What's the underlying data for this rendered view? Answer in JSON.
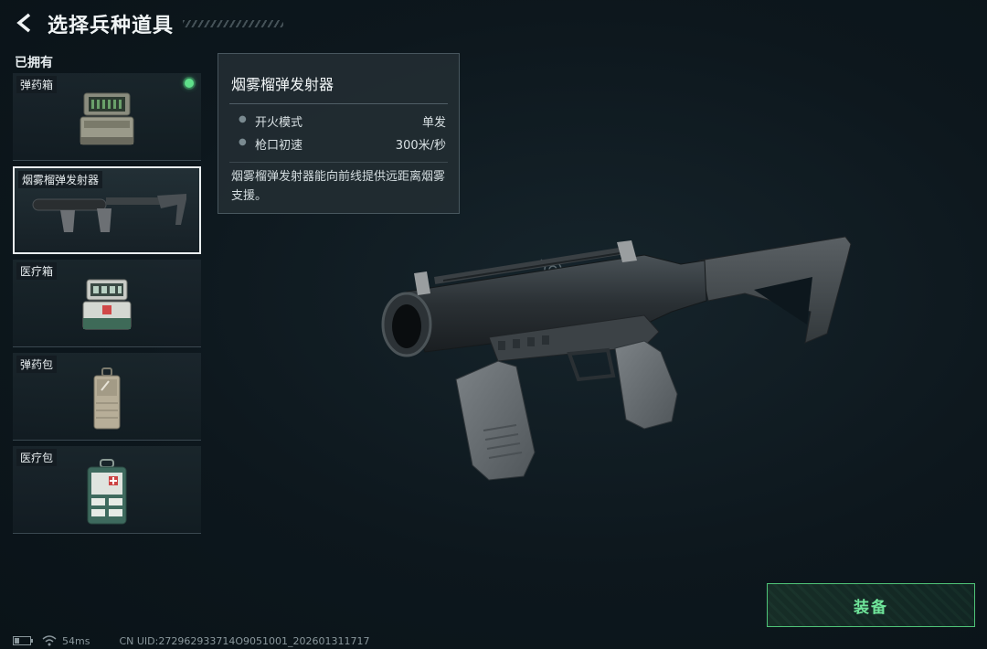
{
  "header": {
    "title": "选择兵种道具",
    "back_icon": "back-arrow-icon"
  },
  "section": {
    "owned_label": "已拥有"
  },
  "items": [
    {
      "label": "弹药箱",
      "icon": "ammo-box-icon",
      "owned_indicator": true,
      "selected": false
    },
    {
      "label": "烟雾榴弹发射器",
      "icon": "smoke-grenade-launcher-icon",
      "owned_indicator": false,
      "selected": true
    },
    {
      "label": "医疗箱",
      "icon": "medical-box-icon",
      "owned_indicator": false,
      "selected": false
    },
    {
      "label": "弹药包",
      "icon": "ammo-pouch-icon",
      "owned_indicator": false,
      "selected": false
    },
    {
      "label": "医疗包",
      "icon": "medical-pouch-icon",
      "owned_indicator": false,
      "selected": false
    }
  ],
  "detail": {
    "name": "烟雾榴弹发射器",
    "stats": [
      {
        "name": "开火模式",
        "value": "单发"
      },
      {
        "name": "枪口初速",
        "value": "300米/秒"
      }
    ],
    "description": "烟雾榴弹发射器能向前线提供远距离烟雾支援。"
  },
  "actions": {
    "equip_label": "装备"
  },
  "status": {
    "ping": "54ms",
    "uid": "CN UID:272962933714O9051001_202601311717"
  },
  "colors": {
    "accent_green": "#5fe08a",
    "equip_border": "#4fc478",
    "panel_bg": "#222c32"
  }
}
